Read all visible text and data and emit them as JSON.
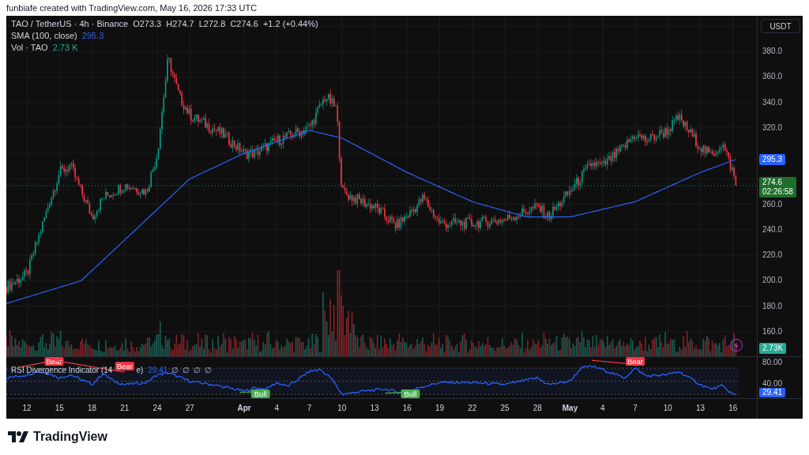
{
  "header": {
    "credit": "funbiafe created with TradingView.com, May 16, 2026 17:33 UTC"
  },
  "legend": {
    "symbol": "TAO / TetherUS · 4h · Binance",
    "ohlc": [
      "O273.3",
      "H274.7",
      "L272.8",
      "C274.6",
      "+1.2 (+0.44%)"
    ],
    "indicators": [
      {
        "name": "SMA (100, close)",
        "value": "295.3",
        "color": "#2962ff"
      },
      {
        "name": "Vol · TAO",
        "value": "2.73 K",
        "color": "#22ab94"
      }
    ]
  },
  "currency_button": "USDT",
  "price_axis": {
    "ticks_upper": [
      "380.0",
      "360.0",
      "340.0",
      "320.0"
    ],
    "ticks_lower": [
      "260.0",
      "240.0",
      "220.0",
      "200.0",
      "180.0",
      "160.0"
    ],
    "markers": [
      {
        "kind": "sma",
        "text": "295.3",
        "color": "#2962ff"
      },
      {
        "kind": "price",
        "text": "274.6",
        "countdown": "02:26:58",
        "color": "#1e6e2a"
      },
      {
        "kind": "volume",
        "text": "2.73K",
        "color": "#22ab94"
      }
    ]
  },
  "rsi": {
    "name": "RSI Divergence Indicator (14",
    "name_tail": "e)",
    "value": "29.41",
    "na_marks": [
      "∅",
      "∅",
      "∅",
      "∅"
    ],
    "ticks": [
      "80.00",
      "40.00"
    ],
    "tags": [
      {
        "kind": "bear",
        "text": "Bear"
      },
      {
        "kind": "bear",
        "text": "Bear"
      },
      {
        "kind": "bull",
        "text": "Bull"
      },
      {
        "kind": "bull",
        "text": "Bull"
      },
      {
        "kind": "bear",
        "text": "Bear"
      }
    ],
    "marker": {
      "text": "29.41",
      "color": "#2962ff"
    }
  },
  "time_axis": {
    "ticks": [
      {
        "label": "12",
        "kind": "day"
      },
      {
        "label": "15",
        "kind": "day"
      },
      {
        "label": "18",
        "kind": "day"
      },
      {
        "label": "21",
        "kind": "day"
      },
      {
        "label": "24",
        "kind": "day"
      },
      {
        "label": "27",
        "kind": "day"
      },
      {
        "label": "Apr",
        "kind": "month"
      },
      {
        "label": "4",
        "kind": "day"
      },
      {
        "label": "7",
        "kind": "day"
      },
      {
        "label": "10",
        "kind": "day"
      },
      {
        "label": "13",
        "kind": "day"
      },
      {
        "label": "16",
        "kind": "day"
      },
      {
        "label": "19",
        "kind": "day"
      },
      {
        "label": "22",
        "kind": "day"
      },
      {
        "label": "25",
        "kind": "day"
      },
      {
        "label": "28",
        "kind": "day"
      },
      {
        "label": "May",
        "kind": "month"
      },
      {
        "label": "4",
        "kind": "day"
      },
      {
        "label": "7",
        "kind": "day"
      },
      {
        "label": "10",
        "kind": "day"
      },
      {
        "label": "13",
        "kind": "day"
      },
      {
        "label": "16",
        "kind": "day"
      }
    ]
  },
  "footer": {
    "brand": "TradingView"
  }
}
